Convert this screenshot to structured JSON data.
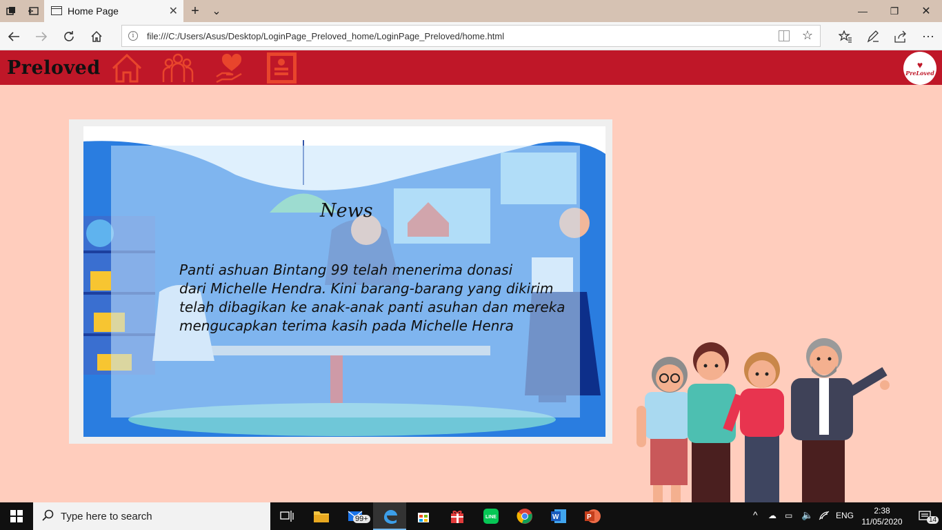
{
  "browser": {
    "tab_title": "Home Page",
    "url": "file:///C:/Users/Asus/Desktop/LoginPage_Preloved_home/LoginPage_Preloved/home.html",
    "tab_close": "✕",
    "new_tab": "+",
    "tab_list": "⌄",
    "window_minimize": "—",
    "window_restore": "❐",
    "window_close": "✕"
  },
  "site": {
    "brand": "Preloved",
    "logo_text": "PreLoved",
    "nav": [
      {
        "name": "home",
        "icon": "house-icon"
      },
      {
        "name": "community",
        "icon": "people-icon"
      },
      {
        "name": "donate",
        "icon": "heart-hand-icon"
      },
      {
        "name": "profile",
        "icon": "id-card-icon"
      }
    ],
    "header_color": "#bf1728",
    "icon_color": "#e8452c",
    "background": "#ffcdbd"
  },
  "news": {
    "title": "News",
    "lines": [
      "Panti ashuan Bintang 99 telah menerima donasi",
      "dari Michelle Hendra. Kini barang-barang yang dikirim",
      "telah dibagikan ke anak-anak panti asuhan dan mereka",
      "mengucapkan terima kasih pada Michelle Henra"
    ]
  },
  "taskbar": {
    "search_placeholder": "Type here to search",
    "mail_badge": "99+",
    "language": "ENG",
    "time": "2:38",
    "date": "11/05/2020",
    "notifications": "14"
  }
}
